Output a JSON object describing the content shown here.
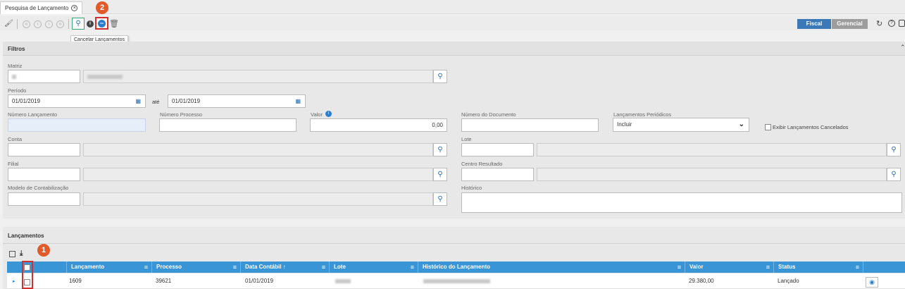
{
  "tab": {
    "title": "Pesquisa de Lançamento"
  },
  "toolbar": {
    "fiscal_label": "Fiscal",
    "gerencial_label": "Gerencial",
    "tooltip": "Cancelar Lançamentos"
  },
  "annotations": {
    "badge1": "1",
    "badge2": "2"
  },
  "filters": {
    "title": "Filtros",
    "matriz_label": "Matriz",
    "periodo_label": "Período",
    "periodo_start": "01/01/2019",
    "ate_label": "até",
    "periodo_end": "01/01/2019",
    "numero_lancamento_label": "Número Lançamento",
    "numero_processo_label": "Número Processo",
    "valor_label": "Valor",
    "valor_value": "0,00",
    "numero_documento_label": "Número do Documento",
    "lanc_periodicos_label": "Lançamentos Periódicos",
    "lanc_periodicos_value": "Incluir",
    "exibir_cancelados_label": "Exibir Lançamentos Cancelados",
    "conta_label": "Conta",
    "lote_label": "Lote",
    "filial_label": "Filial",
    "centro_resultado_label": "Centro Resultado",
    "modelo_label": "Modelo de Contabilização",
    "historico_label": "Histórico"
  },
  "grid": {
    "title": "Lançamentos",
    "columns": [
      "Lançamento",
      "Processo",
      "Data Contábil",
      "Lote",
      "Histórico do Lançamento",
      "Valor",
      "Status"
    ],
    "rows": [
      {
        "lancamento": "1609",
        "processo": "39621",
        "data": "01/01/2019",
        "valor": "29.380,00",
        "status": "Lançado"
      }
    ]
  }
}
